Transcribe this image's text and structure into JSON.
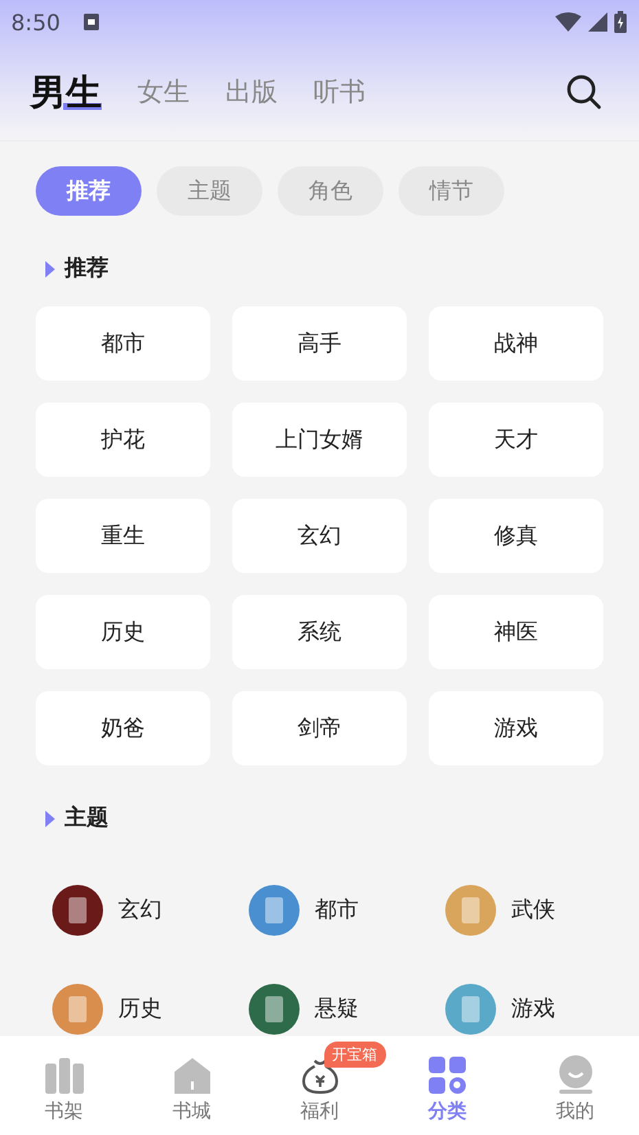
{
  "status_bar": {
    "time": "8:50"
  },
  "top_tabs": [
    {
      "label": "男生",
      "selected": true
    },
    {
      "label": "女生",
      "selected": false
    },
    {
      "label": "出版",
      "selected": false
    },
    {
      "label": "听书",
      "selected": false
    }
  ],
  "filter_chips": [
    {
      "label": "推荐",
      "selected": true
    },
    {
      "label": "主题",
      "selected": false
    },
    {
      "label": "角色",
      "selected": false
    },
    {
      "label": "情节",
      "selected": false
    }
  ],
  "sections": [
    {
      "title": "推荐",
      "kind": "tags",
      "items": [
        {
          "label": "都市"
        },
        {
          "label": "高手"
        },
        {
          "label": "战神"
        },
        {
          "label": "护花"
        },
        {
          "label": "上门女婿"
        },
        {
          "label": "天才"
        },
        {
          "label": "重生"
        },
        {
          "label": "玄幻"
        },
        {
          "label": "修真"
        },
        {
          "label": "历史"
        },
        {
          "label": "系统"
        },
        {
          "label": "神医"
        },
        {
          "label": "奶爸"
        },
        {
          "label": "剑帝"
        },
        {
          "label": "游戏"
        }
      ]
    },
    {
      "title": "主题",
      "kind": "themes",
      "items": [
        {
          "label": "玄幻",
          "color": "#6b1a1a"
        },
        {
          "label": "都市",
          "color": "#4a90d0"
        },
        {
          "label": "武侠",
          "color": "#d9a55c"
        },
        {
          "label": "历史",
          "color": "#d98e4e"
        },
        {
          "label": "悬疑",
          "color": "#2e6b4a"
        },
        {
          "label": "游戏",
          "color": "#5aa9c9"
        }
      ]
    }
  ],
  "bottom_nav": [
    {
      "label": "书架",
      "selected": false
    },
    {
      "label": "书城",
      "selected": false
    },
    {
      "label": "福利",
      "selected": false,
      "badge": "开宝箱"
    },
    {
      "label": "分类",
      "selected": true
    },
    {
      "label": "我的",
      "selected": false
    }
  ]
}
